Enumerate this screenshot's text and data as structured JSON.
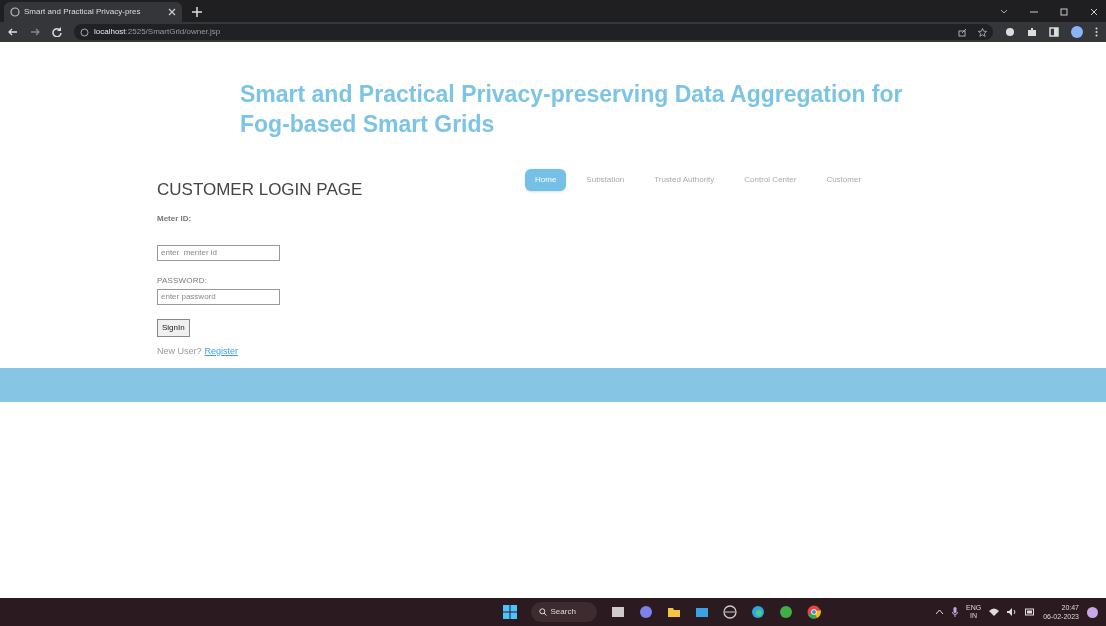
{
  "browser": {
    "tab_title": "Smart and Practical Privacy-pres",
    "url_host": "localhost",
    "url_path": ":2525/SmartGrid/owner.jsp"
  },
  "site_title": "Smart and Practical Privacy-preserving Data Aggregation for Fog-based Smart Grids",
  "heading": "CUSTOMER LOGIN PAGE",
  "nav": [
    {
      "label": "Home",
      "selected": true
    },
    {
      "label": "Substation",
      "selected": false
    },
    {
      "label": "Trusted Authority",
      "selected": false
    },
    {
      "label": "Control Center",
      "selected": false
    },
    {
      "label": "Customer",
      "selected": false
    }
  ],
  "form": {
    "fields": [
      {
        "label": "Meter ID:",
        "placeholder": "enter  menter id"
      },
      {
        "label": "PASSWORD:",
        "placeholder": "enter password"
      }
    ],
    "submit": "SignIn",
    "new_user": "New User?",
    "register": "Register"
  },
  "taskbar": {
    "search": "Search",
    "lang": "ENG",
    "region": "IN",
    "time": "20:47",
    "date": "06-02-2023"
  }
}
